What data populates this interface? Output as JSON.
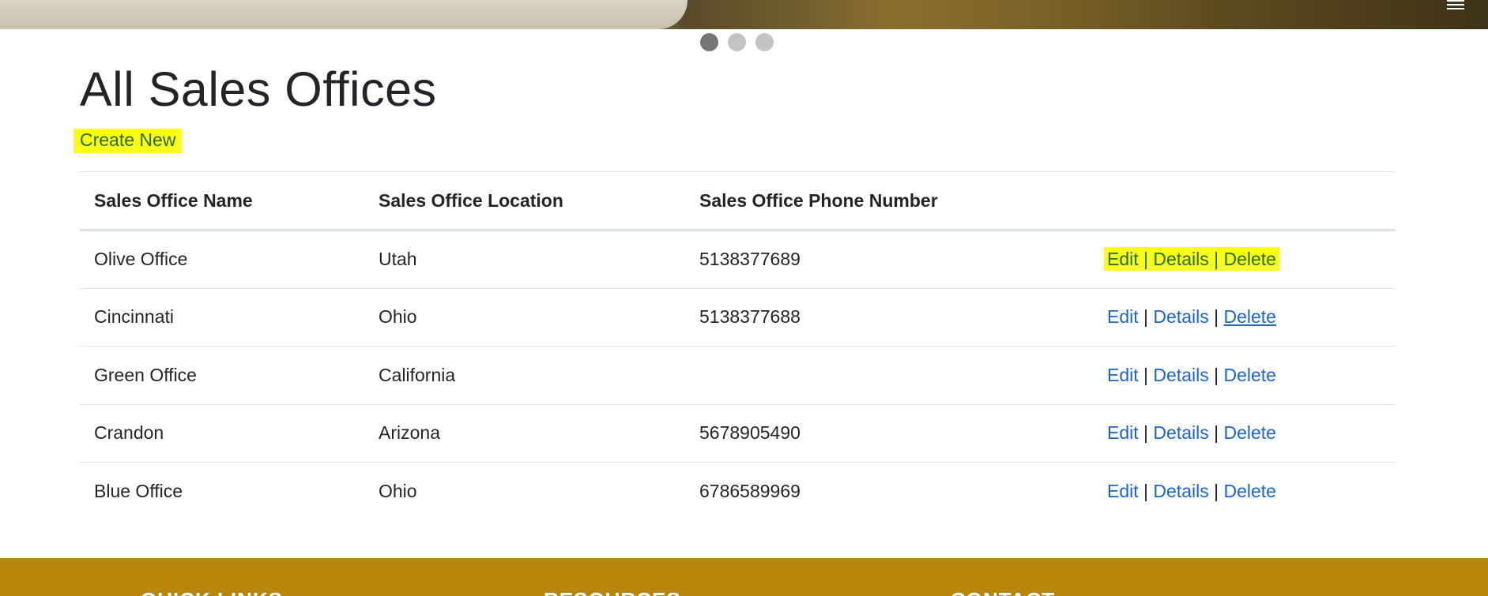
{
  "hero": {
    "menu_icon": "hamburger-menu-icon"
  },
  "carousel": {
    "dots": 3,
    "active_index": 0
  },
  "page": {
    "title": "All Sales Offices",
    "create_new_label": "Create New"
  },
  "table": {
    "headers": [
      "Sales Office Name",
      "Sales Office Location",
      "Sales Office Phone Number",
      ""
    ],
    "rows": [
      {
        "name": "Olive Office",
        "location": "Utah",
        "phone": "5138377689"
      },
      {
        "name": "Cincinnati",
        "location": "Ohio",
        "phone": "5138377688"
      },
      {
        "name": "Green Office",
        "location": "California",
        "phone": ""
      },
      {
        "name": "Crandon",
        "location": "Arizona",
        "phone": "5678905490"
      },
      {
        "name": "Blue Office",
        "location": "Ohio",
        "phone": "6786589969"
      }
    ],
    "actions": {
      "edit": "Edit",
      "details": "Details",
      "delete": "Delete",
      "separator": "|"
    }
  },
  "footer": {
    "headings": [
      "QUICK LINKS",
      "RESOURCES",
      "CONTACT"
    ]
  },
  "colors": {
    "highlight": "#faff19",
    "link": "#1a64d2",
    "footer_bg": "#b8860b"
  }
}
